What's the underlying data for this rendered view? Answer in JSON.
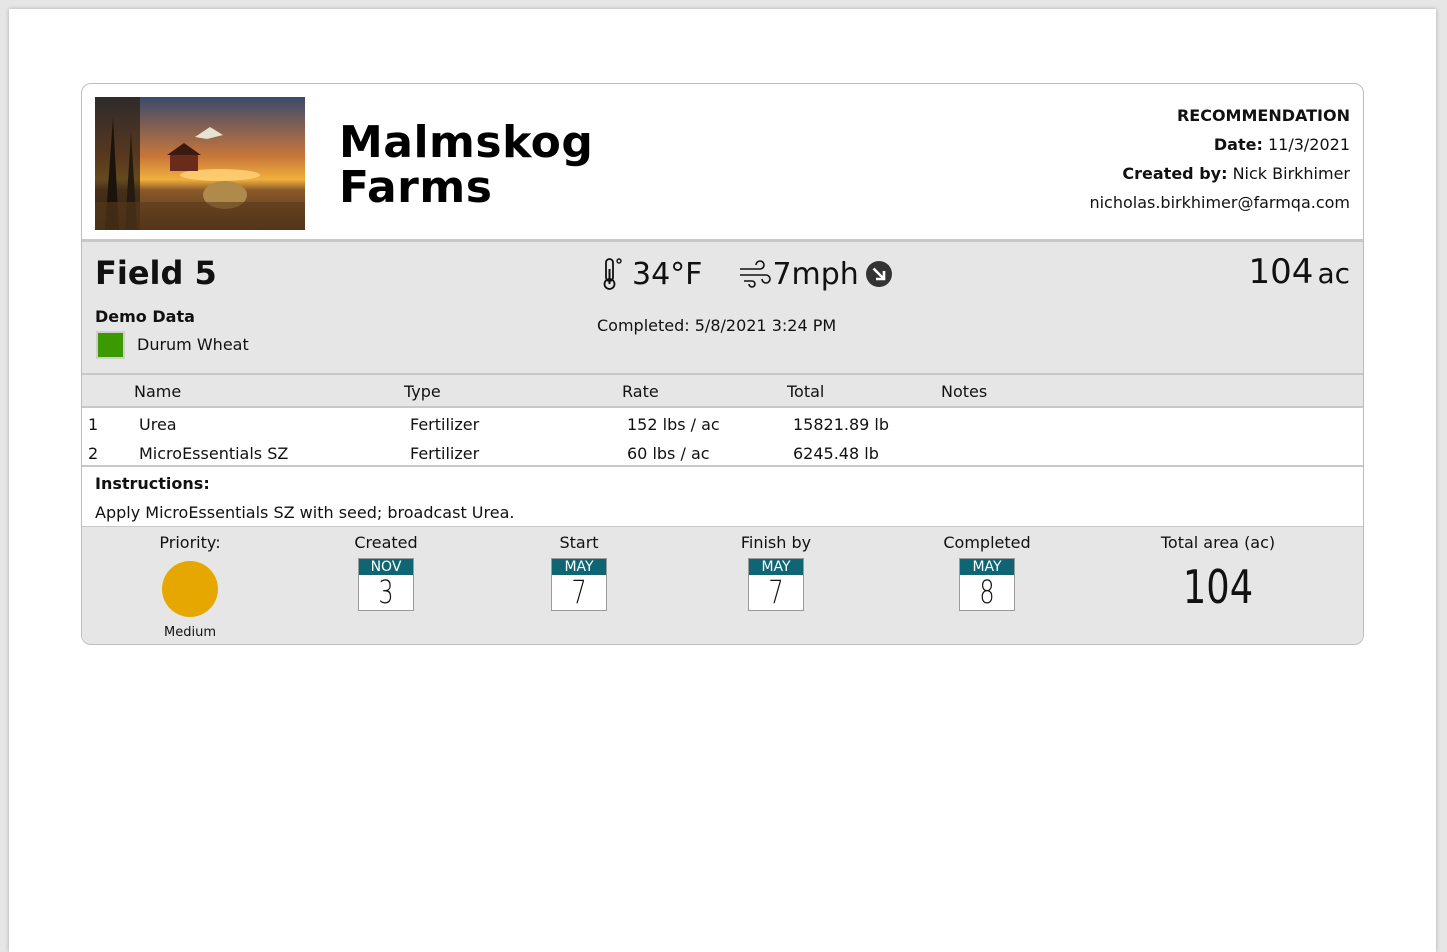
{
  "header": {
    "farm_name_line1": "Malmskog",
    "farm_name_line2": "Farms",
    "doc_type": "RECOMMENDATION",
    "date_label": "Date:",
    "date_value": "11/3/2021",
    "created_by_label": "Created by:",
    "created_by_value": "Nick Birkhimer",
    "email": "nicholas.birkhimer@farmqa.com"
  },
  "field": {
    "name": "Field 5",
    "farm_label": "Demo Data",
    "crop": "Durum Wheat",
    "crop_color": "#3a9a00",
    "temperature": "34°F",
    "wind_speed": "7mph",
    "completed": "Completed: 5/8/2021 3:24 PM",
    "area_value": "104",
    "area_unit": "ac"
  },
  "items": {
    "headers": [
      "Name",
      "Type",
      "Rate",
      "Total",
      "Notes"
    ],
    "rows": [
      {
        "num": "1",
        "name": "Urea",
        "type": "Fertilizer",
        "rate": "152 lbs / ac",
        "total": "15821.89 lb",
        "notes": ""
      },
      {
        "num": "2",
        "name": "MicroEssentials SZ",
        "type": "Fertilizer",
        "rate": "60 lbs / ac",
        "total": "6245.48 lb",
        "notes": ""
      }
    ]
  },
  "instructions": {
    "label": "Instructions:",
    "text": "Apply MicroEssentials SZ with seed; broadcast Urea."
  },
  "footer": {
    "priority_label": "Priority:",
    "priority_value": "Medium",
    "priority_color": "#e6a800",
    "created": {
      "label": "Created",
      "month": "NOV",
      "day": "3"
    },
    "start": {
      "label": "Start",
      "month": "MAY",
      "day": "7"
    },
    "finish": {
      "label": "Finish by",
      "month": "MAY",
      "day": "7"
    },
    "completed": {
      "label": "Completed",
      "month": "MAY",
      "day": "8"
    },
    "total_area_label": "Total area (ac)",
    "total_area_value": "104"
  },
  "icons": {
    "thermometer": "thermometer-icon",
    "wind": "wind-icon",
    "wind_direction": "wind-direction-arrow-icon"
  }
}
